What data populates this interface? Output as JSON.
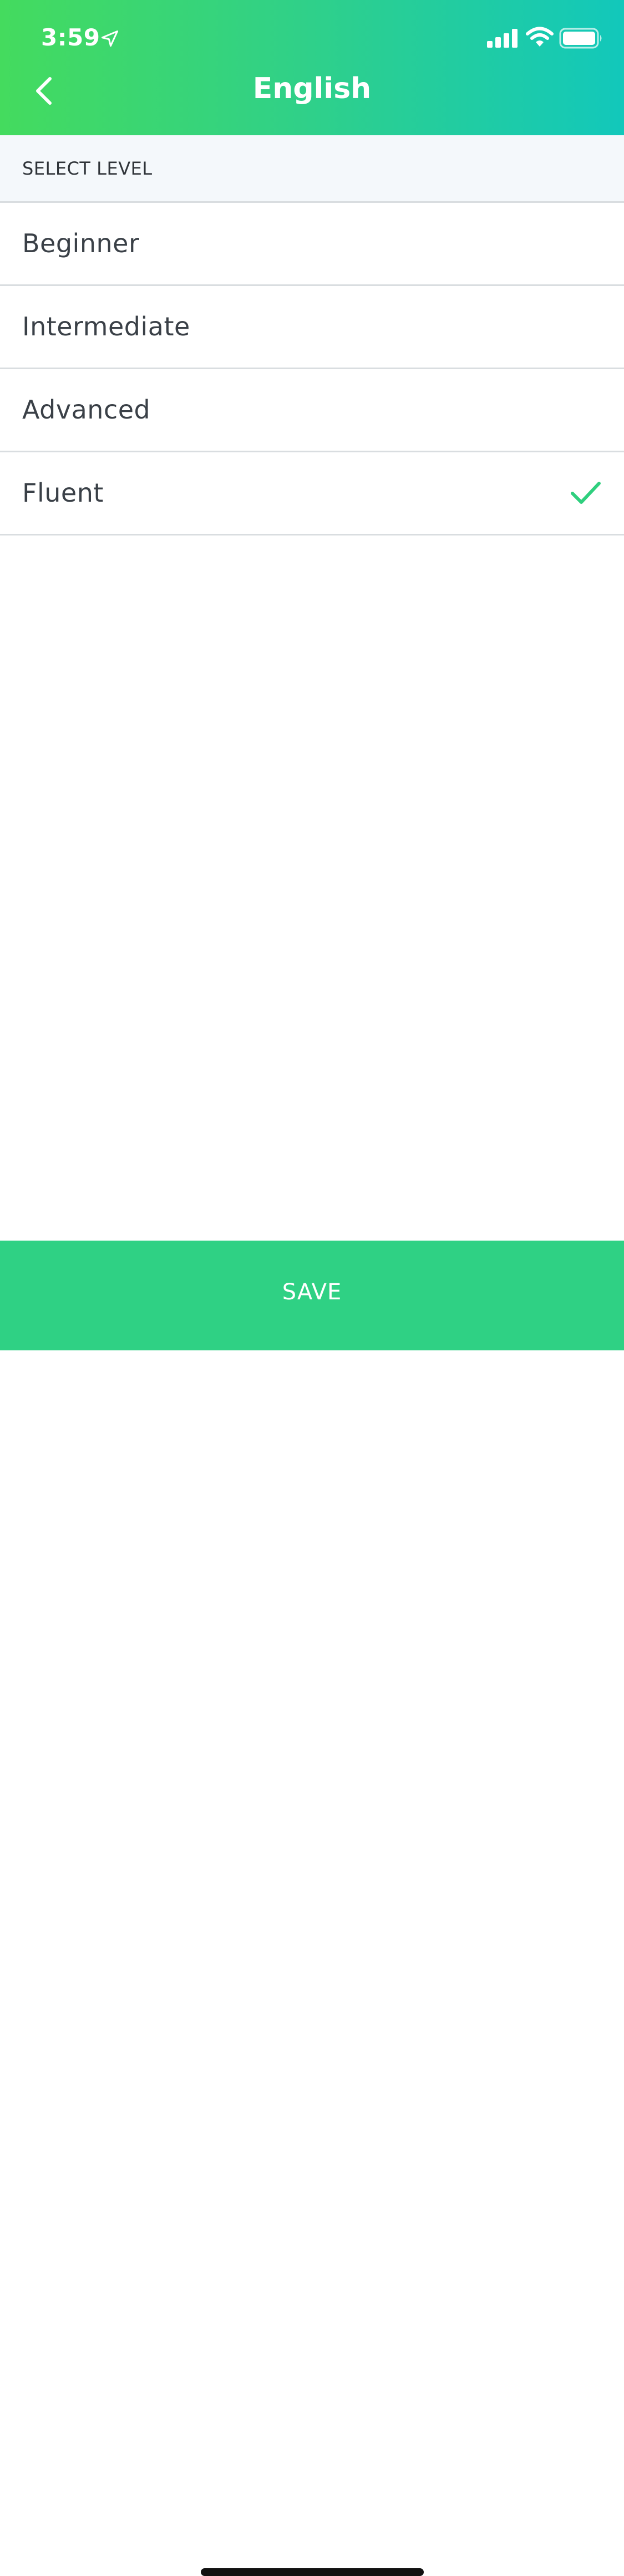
{
  "status_bar": {
    "time": "3:59",
    "icons": [
      "location-arrow-icon",
      "cellular-signal-icon",
      "wifi-icon",
      "battery-icon"
    ]
  },
  "nav": {
    "title": "English",
    "back_icon": "chevron-left-icon"
  },
  "section": {
    "title": "SELECT LEVEL"
  },
  "levels": [
    {
      "label": "Beginner",
      "selected": false
    },
    {
      "label": "Intermediate",
      "selected": false
    },
    {
      "label": "Advanced",
      "selected": false
    },
    {
      "label": "Fluent",
      "selected": true
    }
  ],
  "save_button": {
    "label": "SAVE"
  },
  "colors": {
    "gradient_start": "#44db5e",
    "gradient_end": "#12c8bb",
    "accent": "#2fd184",
    "check": "#2fcf7e",
    "section_bg": "#f4f8fb",
    "text": "#3a4047",
    "divider": "#d9dde0"
  }
}
